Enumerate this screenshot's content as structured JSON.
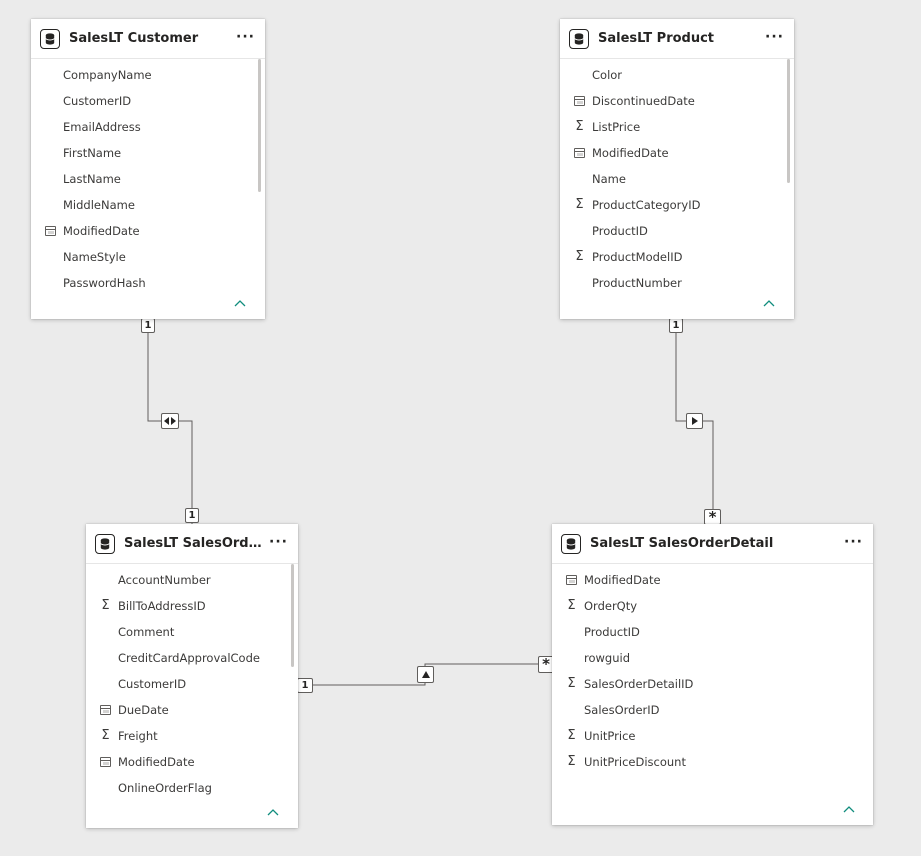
{
  "tables": [
    {
      "id": "customer",
      "title": "SalesLT Customer",
      "more_label": "···",
      "fields": [
        {
          "name": "CompanyName",
          "icon": ""
        },
        {
          "name": "CustomerID",
          "icon": ""
        },
        {
          "name": "EmailAddress",
          "icon": ""
        },
        {
          "name": "FirstName",
          "icon": ""
        },
        {
          "name": "LastName",
          "icon": ""
        },
        {
          "name": "MiddleName",
          "icon": ""
        },
        {
          "name": "ModifiedDate",
          "icon": "calendar-icon"
        },
        {
          "name": "NameStyle",
          "icon": ""
        },
        {
          "name": "PasswordHash",
          "icon": ""
        }
      ]
    },
    {
      "id": "product",
      "title": "SalesLT Product",
      "more_label": "···",
      "fields": [
        {
          "name": "Color",
          "icon": ""
        },
        {
          "name": "DiscontinuedDate",
          "icon": "calendar-icon"
        },
        {
          "name": "ListPrice",
          "icon": "sigma-icon"
        },
        {
          "name": "ModifiedDate",
          "icon": "calendar-icon"
        },
        {
          "name": "Name",
          "icon": ""
        },
        {
          "name": "ProductCategoryID",
          "icon": "sigma-icon"
        },
        {
          "name": "ProductID",
          "icon": ""
        },
        {
          "name": "ProductModelID",
          "icon": "sigma-icon"
        },
        {
          "name": "ProductNumber",
          "icon": ""
        }
      ]
    },
    {
      "id": "orderheader",
      "title": "SalesLT SalesOrderH...",
      "more_label": "···",
      "fields": [
        {
          "name": "AccountNumber",
          "icon": ""
        },
        {
          "name": "BillToAddressID",
          "icon": "sigma-icon"
        },
        {
          "name": "Comment",
          "icon": ""
        },
        {
          "name": "CreditCardApprovalCode",
          "icon": ""
        },
        {
          "name": "CustomerID",
          "icon": ""
        },
        {
          "name": "DueDate",
          "icon": "calendar-icon"
        },
        {
          "name": "Freight",
          "icon": "sigma-icon"
        },
        {
          "name": "ModifiedDate",
          "icon": "calendar-icon"
        },
        {
          "name": "OnlineOrderFlag",
          "icon": ""
        }
      ]
    },
    {
      "id": "orderdetail",
      "title": "SalesLT SalesOrderDetail",
      "more_label": "···",
      "fields": [
        {
          "name": "ModifiedDate",
          "icon": "calendar-icon"
        },
        {
          "name": "OrderQty",
          "icon": "sigma-icon"
        },
        {
          "name": "ProductID",
          "icon": ""
        },
        {
          "name": "rowguid",
          "icon": ""
        },
        {
          "name": "SalesOrderDetailID",
          "icon": "sigma-icon"
        },
        {
          "name": "SalesOrderID",
          "icon": ""
        },
        {
          "name": "UnitPrice",
          "icon": "sigma-icon"
        },
        {
          "name": "UnitPriceDiscount",
          "icon": "sigma-icon"
        }
      ]
    }
  ],
  "relationships": [
    {
      "from": "customer",
      "to": "orderheader",
      "from_cardinality": "1",
      "to_cardinality": "1",
      "cross_filter": "both"
    },
    {
      "from": "product",
      "to": "orderdetail",
      "from_cardinality": "1",
      "to_cardinality": "*",
      "cross_filter": "single"
    },
    {
      "from": "orderheader",
      "to": "orderdetail",
      "from_cardinality": "1",
      "to_cardinality": "*",
      "cross_filter": "single"
    }
  ],
  "colors": {
    "canvas": "#ebebeb",
    "card": "#ffffff",
    "line": "#605e5c",
    "accent": "#118d7e"
  }
}
